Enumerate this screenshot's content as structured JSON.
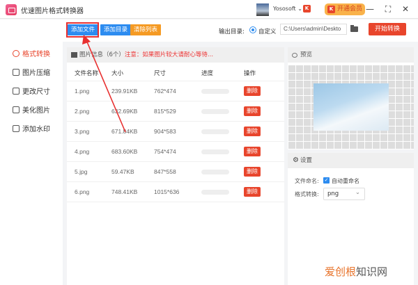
{
  "app": {
    "title": "优速图片格式转换器",
    "user": "Yososoft",
    "vip_label": "开通会员"
  },
  "toolbar": {
    "add_file": "添加文件",
    "add_folder": "添加目录",
    "clear_list": "清除列表",
    "output_label": "输出目录:",
    "custom_label": "自定义",
    "output_path": "C:\\Users\\admin\\Deskto",
    "start": "开始转换"
  },
  "sidebar": {
    "items": [
      {
        "label": "格式转换",
        "active": true
      },
      {
        "label": "图片压缩"
      },
      {
        "label": "更改尺寸"
      },
      {
        "label": "美化图片"
      },
      {
        "label": "添加水印"
      }
    ]
  },
  "filelist": {
    "title": "图片信息（6个）",
    "notice": "注意：如果图片较大请耐心等待...",
    "columns": [
      "文件名称",
      "大小",
      "尺寸",
      "进度",
      "操作"
    ],
    "rows": [
      {
        "name": "1.png",
        "size": "239.91KB",
        "dim": "762*474",
        "progress": 0
      },
      {
        "name": "2.png",
        "size": "632.69KB",
        "dim": "815*529",
        "progress": 0
      },
      {
        "name": "3.png",
        "size": "671.84KB",
        "dim": "904*583",
        "progress": 0
      },
      {
        "name": "4.png",
        "size": "683.60KB",
        "dim": "754*474",
        "progress": 0
      },
      {
        "name": "5.jpg",
        "size": "59.47KB",
        "dim": "847*558",
        "progress": 0
      },
      {
        "name": "6.png",
        "size": "748.41KB",
        "dim": "1015*636",
        "progress": 0
      }
    ],
    "delete_label": "删除"
  },
  "preview": {
    "title": "预览"
  },
  "settings": {
    "title": "设置",
    "rename_label": "文件命名:",
    "auto_rename": "自动重命名",
    "auto_rename_checked": true,
    "format_label": "格式转换:",
    "format_value": "png"
  },
  "watermark": {
    "part1": "爱创根",
    "part2": "知识网"
  },
  "colors": {
    "accent": "#e8452c",
    "blue": "#2d8cf0",
    "orange": "#f59a23"
  }
}
